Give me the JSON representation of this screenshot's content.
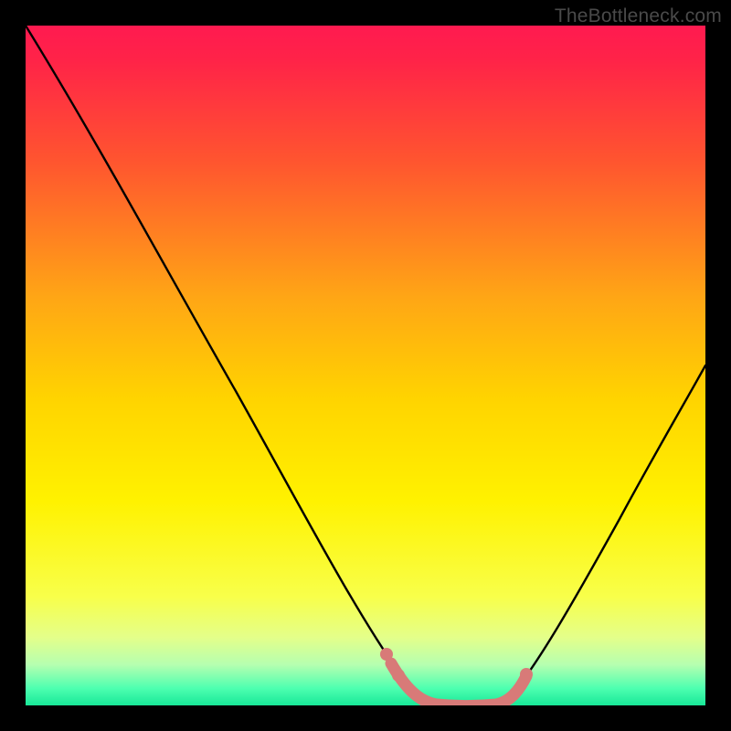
{
  "watermark": {
    "text": "TheBottleneck.com"
  },
  "chart_data": {
    "type": "line",
    "title": "",
    "xlabel": "",
    "ylabel": "",
    "xlim": [
      0,
      100
    ],
    "ylim": [
      0,
      100
    ],
    "grid": false,
    "legend": false,
    "series": [
      {
        "name": "bottleneck-curve",
        "x": [
          0,
          10,
          20,
          30,
          40,
          50,
          55,
          58,
          60,
          62,
          65,
          68,
          70,
          80,
          90,
          100
        ],
        "y": [
          100,
          88,
          73,
          57,
          40,
          22,
          12,
          5,
          2,
          0,
          0,
          0,
          2,
          14,
          30,
          48
        ],
        "color": "#000000"
      }
    ],
    "highlight_segment": {
      "name": "optimal-range",
      "x": [
        55,
        58,
        60,
        62,
        65,
        68,
        70
      ],
      "y": [
        12,
        5,
        2,
        0,
        0,
        0,
        2
      ],
      "color": "#d87a78"
    },
    "background_gradient": {
      "stops": [
        {
          "offset": 0.0,
          "color": "#ff1a50"
        },
        {
          "offset": 0.05,
          "color": "#ff2348"
        },
        {
          "offset": 0.2,
          "color": "#ff552f"
        },
        {
          "offset": 0.4,
          "color": "#ffa615"
        },
        {
          "offset": 0.55,
          "color": "#ffd400"
        },
        {
          "offset": 0.7,
          "color": "#fff200"
        },
        {
          "offset": 0.84,
          "color": "#f8ff4a"
        },
        {
          "offset": 0.9,
          "color": "#e4ff8a"
        },
        {
          "offset": 0.94,
          "color": "#b6ffb0"
        },
        {
          "offset": 0.975,
          "color": "#4dffb0"
        },
        {
          "offset": 1.0,
          "color": "#18e898"
        }
      ]
    }
  }
}
